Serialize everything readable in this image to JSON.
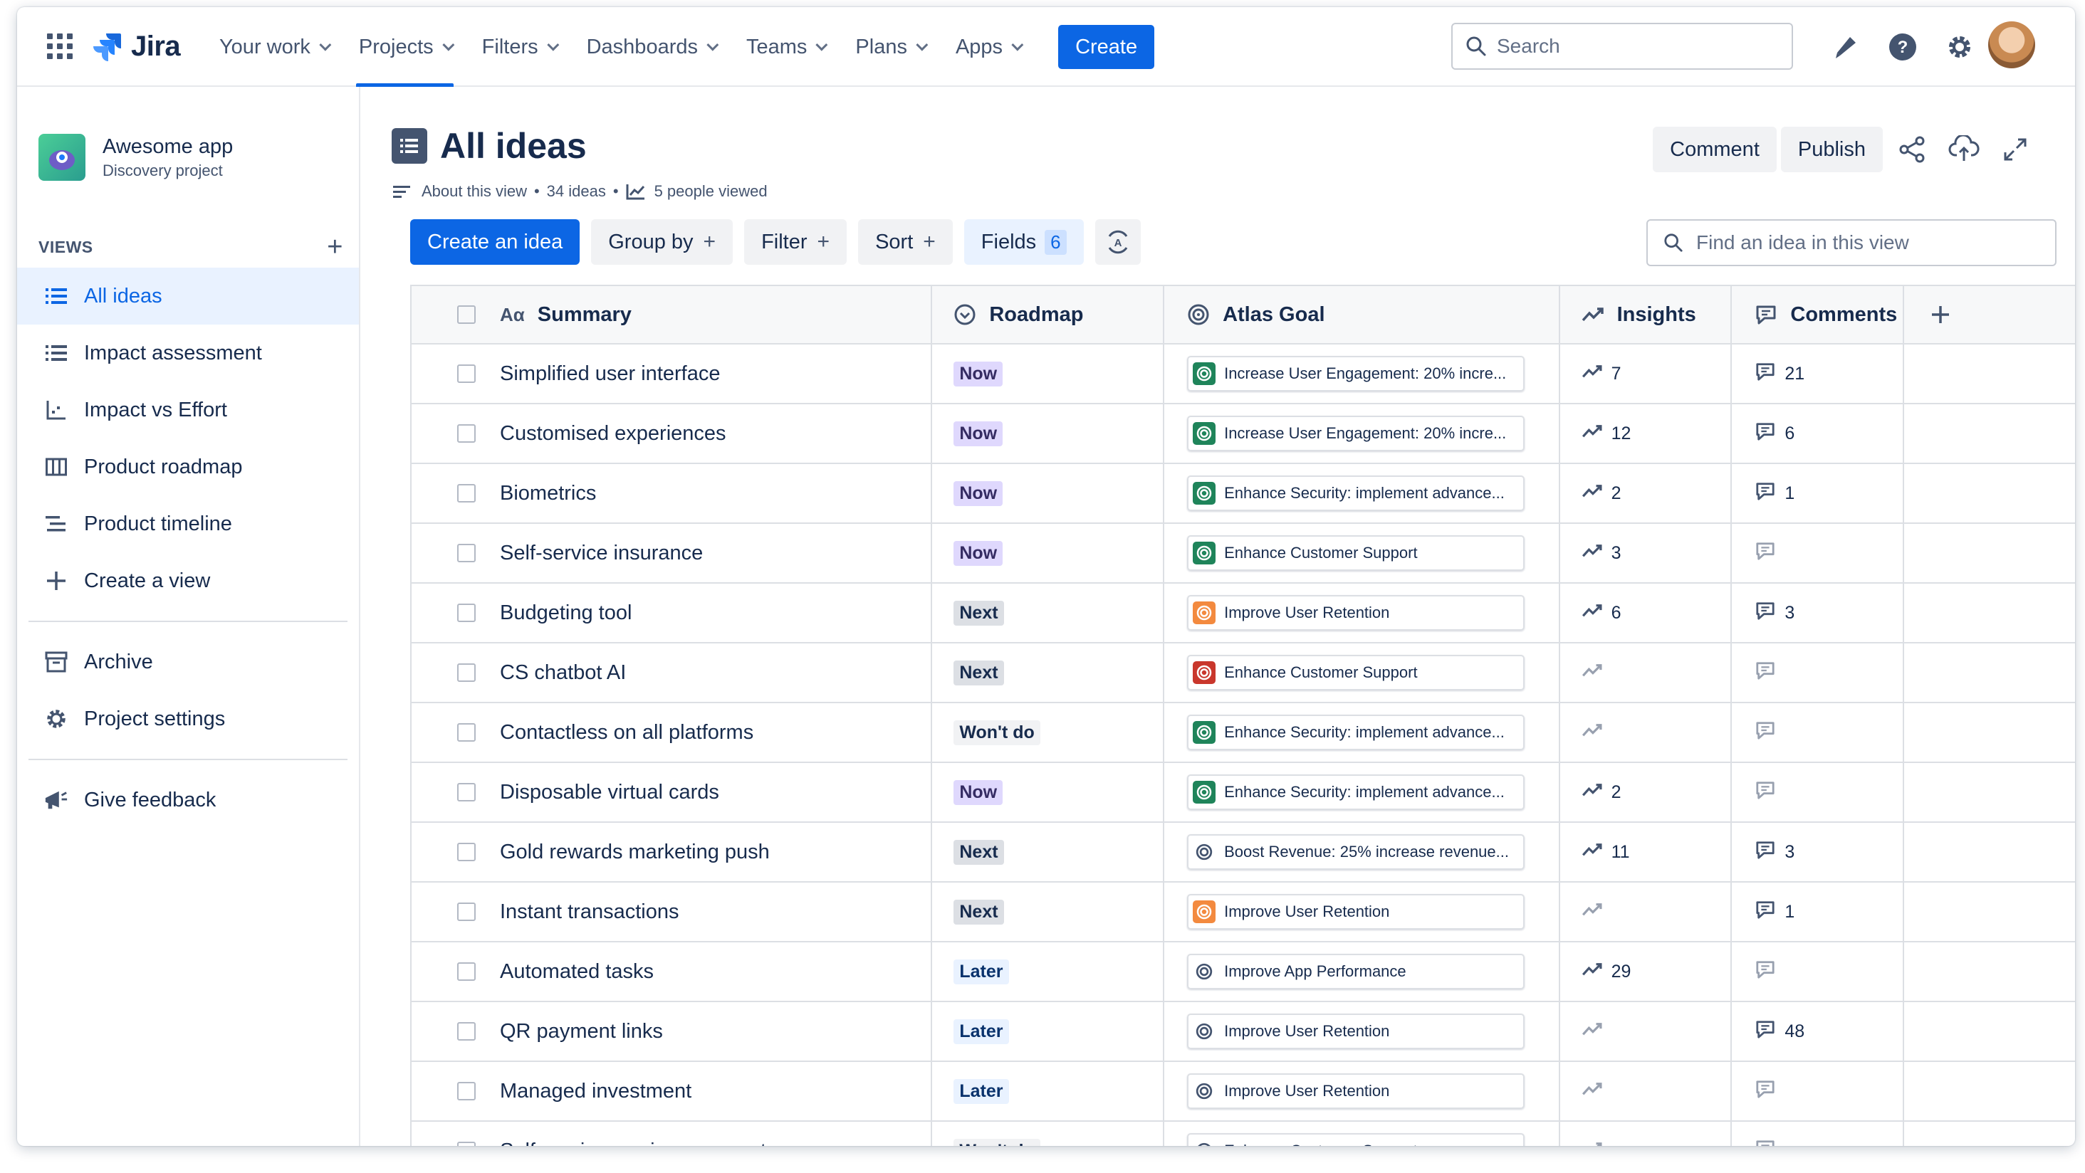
{
  "nav": {
    "logo": "Jira",
    "items": [
      {
        "label": "Your work",
        "active": false
      },
      {
        "label": "Projects",
        "active": true
      },
      {
        "label": "Filters",
        "active": false
      },
      {
        "label": "Dashboards",
        "active": false
      },
      {
        "label": "Teams",
        "active": false
      },
      {
        "label": "Plans",
        "active": false
      },
      {
        "label": "Apps",
        "active": false
      }
    ],
    "create": "Create",
    "search_placeholder": "Search"
  },
  "sidebar": {
    "project_name": "Awesome app",
    "project_type": "Discovery project",
    "views_heading": "VIEWS",
    "views": [
      {
        "label": "All ideas",
        "icon": "list-icon",
        "active": true
      },
      {
        "label": "Impact assessment",
        "icon": "list-icon",
        "active": false
      },
      {
        "label": "Impact vs Effort",
        "icon": "matrix-icon",
        "active": false
      },
      {
        "label": "Product roadmap",
        "icon": "board-icon",
        "active": false
      },
      {
        "label": "Product timeline",
        "icon": "timeline-icon",
        "active": false
      },
      {
        "label": "Create a view",
        "icon": "plus-icon",
        "active": false
      }
    ],
    "archive": "Archive",
    "settings": "Project settings",
    "feedback": "Give feedback"
  },
  "header": {
    "title": "All ideas",
    "about": "About this view",
    "ideas_count": "34 ideas",
    "viewed": "5 people viewed",
    "comment": "Comment",
    "publish": "Publish"
  },
  "toolbar": {
    "create_idea": "Create an idea",
    "group_by": "Group by",
    "filter": "Filter",
    "sort": "Sort",
    "fields": "Fields",
    "fields_count": "6",
    "find_placeholder": "Find an idea in this view"
  },
  "table": {
    "columns": {
      "summary": "Summary",
      "roadmap": "Roadmap",
      "goal": "Atlas Goal",
      "insights": "Insights",
      "comments": "Comments"
    },
    "rows": [
      {
        "summary": "Simplified user interface",
        "roadmap": "Now",
        "goal": "Increase User Engagement: 20% incre...",
        "goal_color": "green",
        "insights": "7",
        "comments": "21"
      },
      {
        "summary": "Customised experiences",
        "roadmap": "Now",
        "goal": "Increase User Engagement: 20% incre...",
        "goal_color": "green",
        "insights": "12",
        "comments": "6"
      },
      {
        "summary": "Biometrics",
        "roadmap": "Now",
        "goal": "Enhance Security: implement advance...",
        "goal_color": "green",
        "insights": "2",
        "comments": "1"
      },
      {
        "summary": "Self-service insurance",
        "roadmap": "Now",
        "goal": "Enhance Customer Support",
        "goal_color": "green",
        "insights": "3",
        "comments": ""
      },
      {
        "summary": "Budgeting tool",
        "roadmap": "Next",
        "goal": "Improve User Retention",
        "goal_color": "orange",
        "insights": "6",
        "comments": "3"
      },
      {
        "summary": "CS chatbot AI",
        "roadmap": "Next",
        "goal": "Enhance Customer Support",
        "goal_color": "red",
        "insights": "",
        "comments": ""
      },
      {
        "summary": "Contactless on all platforms",
        "roadmap": "Won't do",
        "goal": "Enhance Security: implement advance...",
        "goal_color": "green",
        "insights": "",
        "comments": ""
      },
      {
        "summary": "Disposable virtual cards",
        "roadmap": "Now",
        "goal": "Enhance Security: implement advance...",
        "goal_color": "green",
        "insights": "2",
        "comments": ""
      },
      {
        "summary": "Gold rewards marketing push",
        "roadmap": "Next",
        "goal": "Boost Revenue: 25% increase revenue...",
        "goal_color": "grey",
        "insights": "11",
        "comments": "3"
      },
      {
        "summary": "Instant transactions",
        "roadmap": "Next",
        "goal": "Improve User Retention",
        "goal_color": "orange",
        "insights": "",
        "comments": "1"
      },
      {
        "summary": "Automated tasks",
        "roadmap": "Later",
        "goal": "Improve App Performance",
        "goal_color": "grey",
        "insights": "29",
        "comments": ""
      },
      {
        "summary": "QR payment links",
        "roadmap": "Later",
        "goal": "Improve User Retention",
        "goal_color": "grey",
        "insights": "",
        "comments": "48"
      },
      {
        "summary": "Managed investment",
        "roadmap": "Later",
        "goal": "Improve User Retention",
        "goal_color": "grey",
        "insights": "",
        "comments": ""
      },
      {
        "summary": "Self service: savings accounts",
        "roadmap": "Won't do",
        "goal": "Enhance Customer Support",
        "goal_color": "grey",
        "insights": "",
        "comments": ""
      }
    ]
  },
  "colors": {
    "brand": "#0c66e4",
    "now_bg": "#dfd8fd",
    "now_fg": "#352c63",
    "next_bg": "#dcdfe4",
    "next_fg": "#172b4d",
    "later_bg": "#e9f2ff",
    "later_fg": "#09326c",
    "wontdo_bg": "#f1f2f4",
    "wontdo_fg": "#172b4d",
    "goal_green": "#1f845a",
    "goal_orange": "#f38a3f",
    "goal_red": "#c9372c",
    "goal_grey": "#44546f"
  }
}
